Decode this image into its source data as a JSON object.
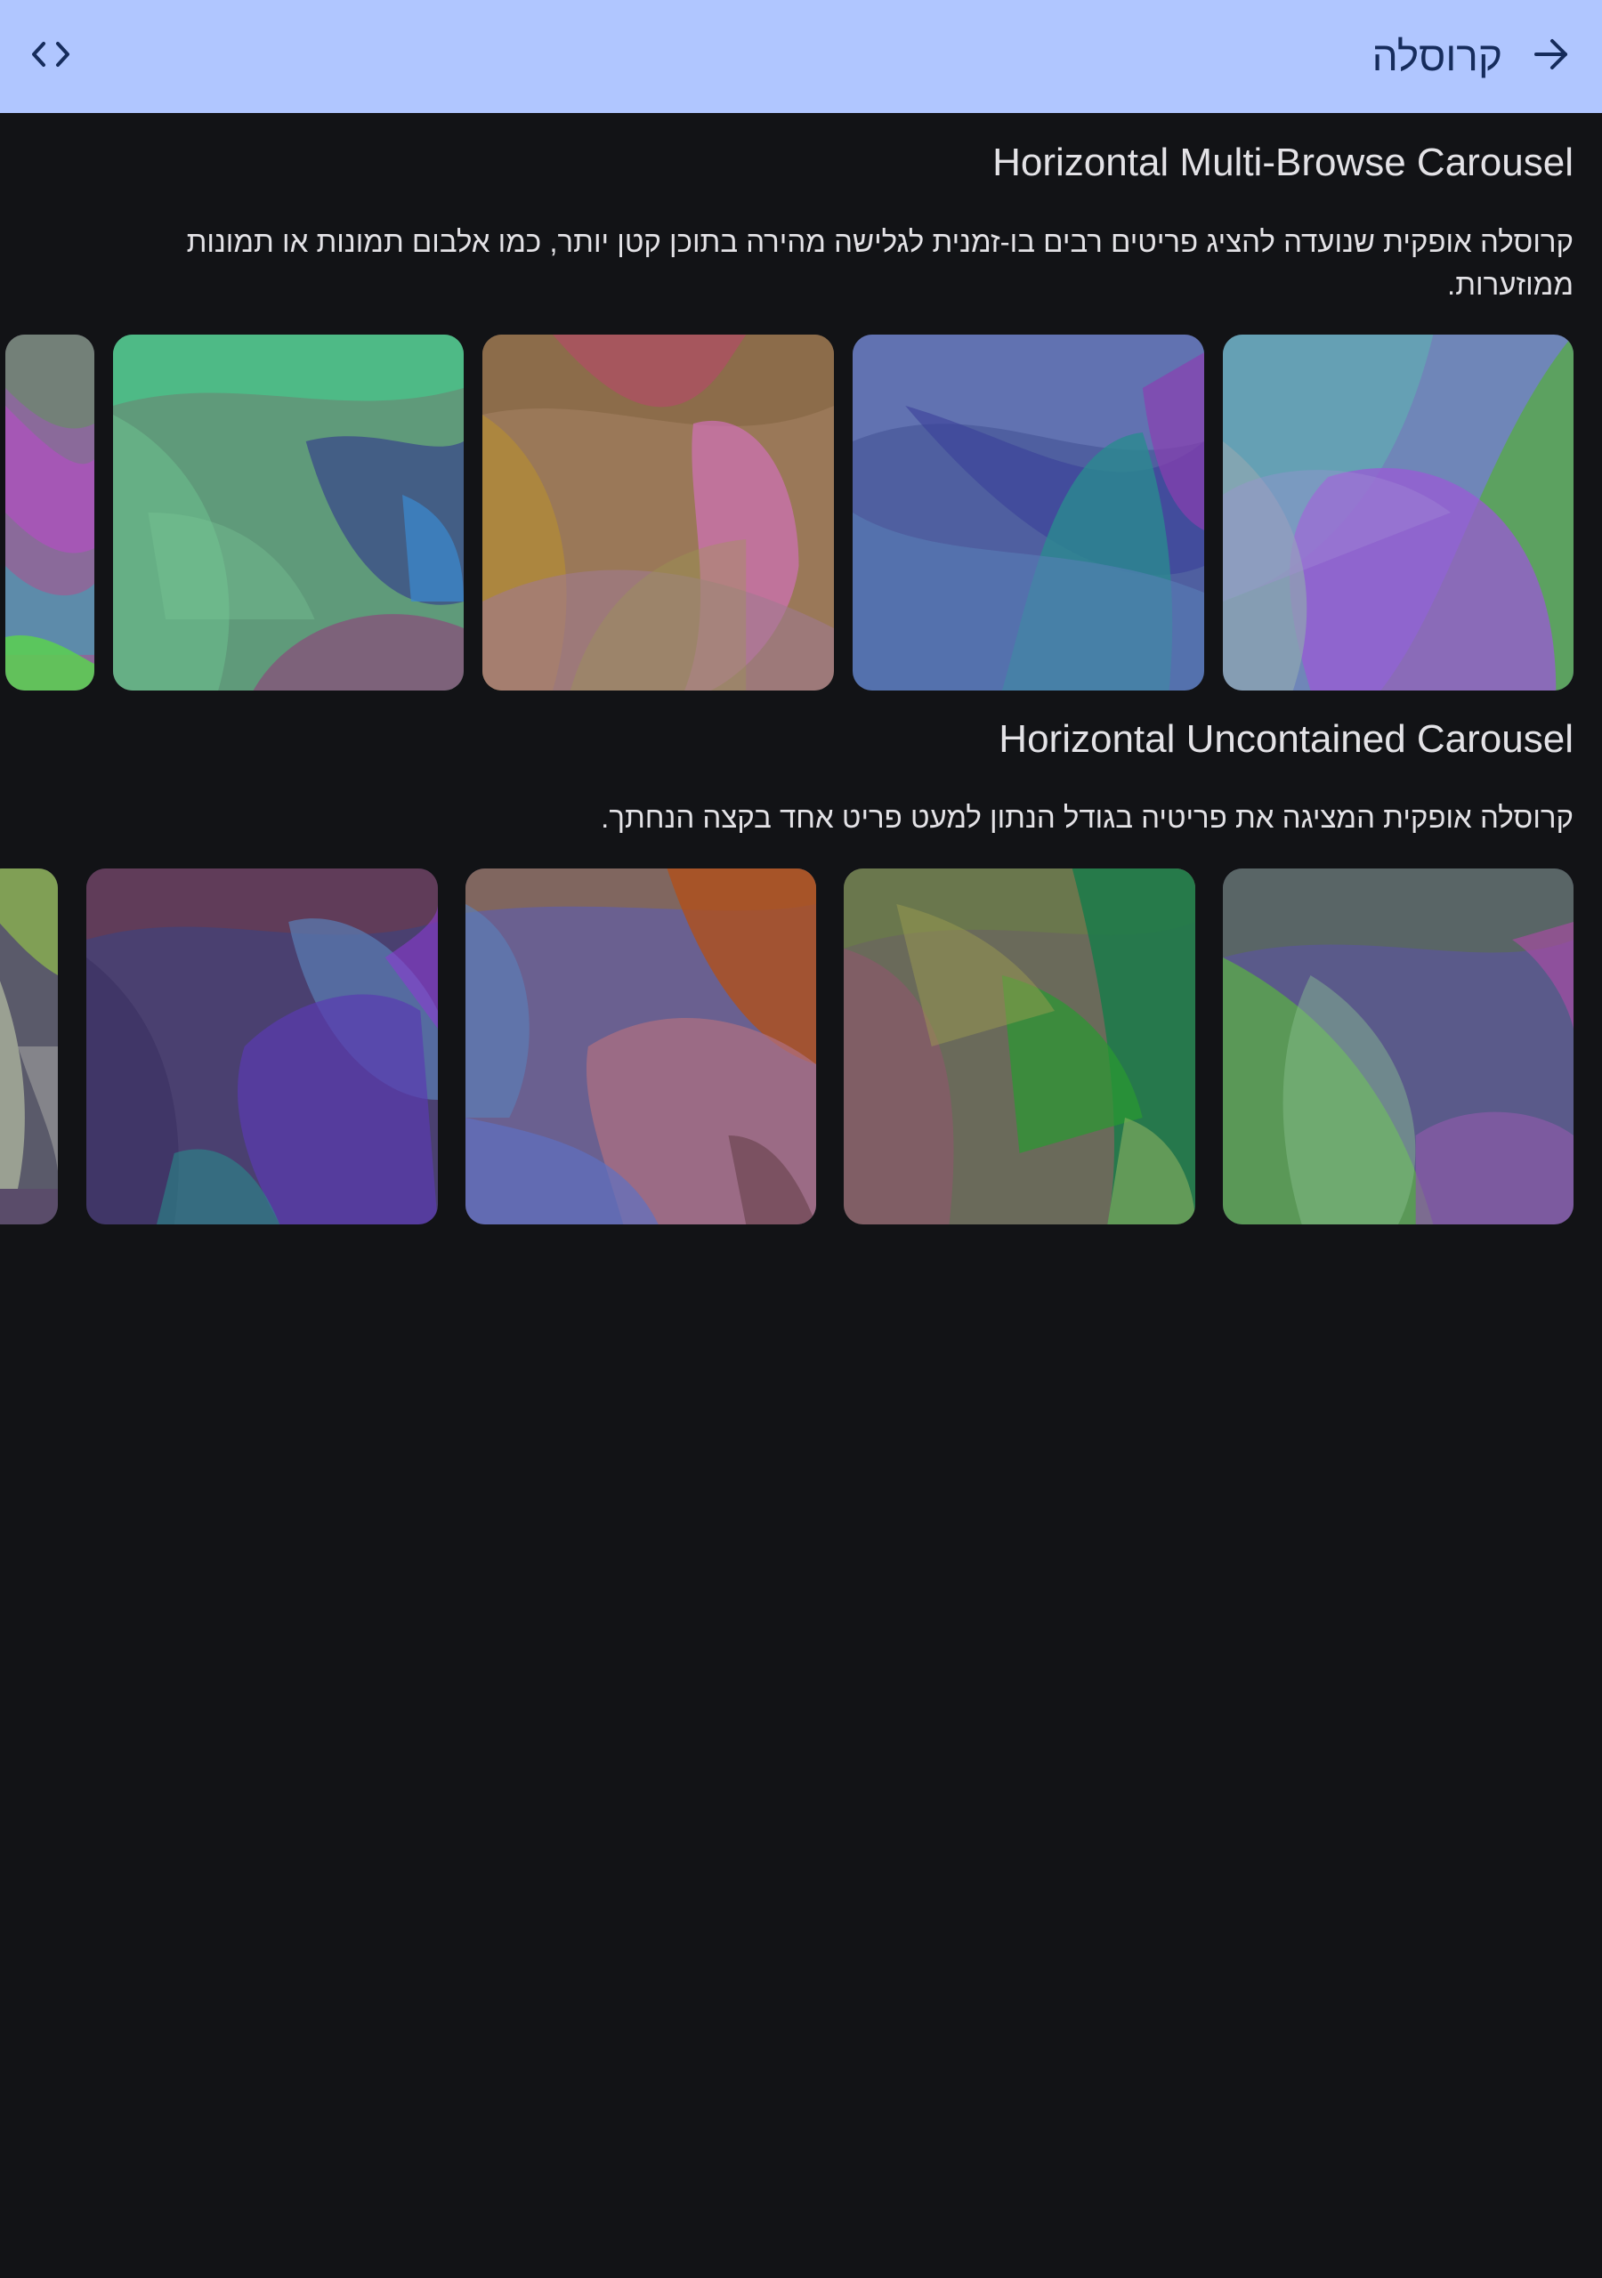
{
  "app_bar": {
    "title": "קרוסלה",
    "back_icon": "arrow-right-icon",
    "code_icon": "code-icon",
    "background": "#b0c6ff",
    "icon_color": "#162c5c"
  },
  "sections": [
    {
      "title": "Horizontal Multi-Browse Carousel",
      "description": "קרוסלה אופקית שנועדה להציג פריטים רבים בו-זמנית לגלישה מהירה בתוכן קטן יותר, כמו אלבום תמונות או תמונות ממוזערות."
    },
    {
      "title": "Horizontal Uncontained Carousel",
      "description": "קרוסלה אופקית המציגה את פריטיה בגודל הנתון למעט פריט אחד בקצה הנחתך."
    }
  ],
  "colors": {
    "background": "#121316",
    "text": "#e3e2e6"
  }
}
